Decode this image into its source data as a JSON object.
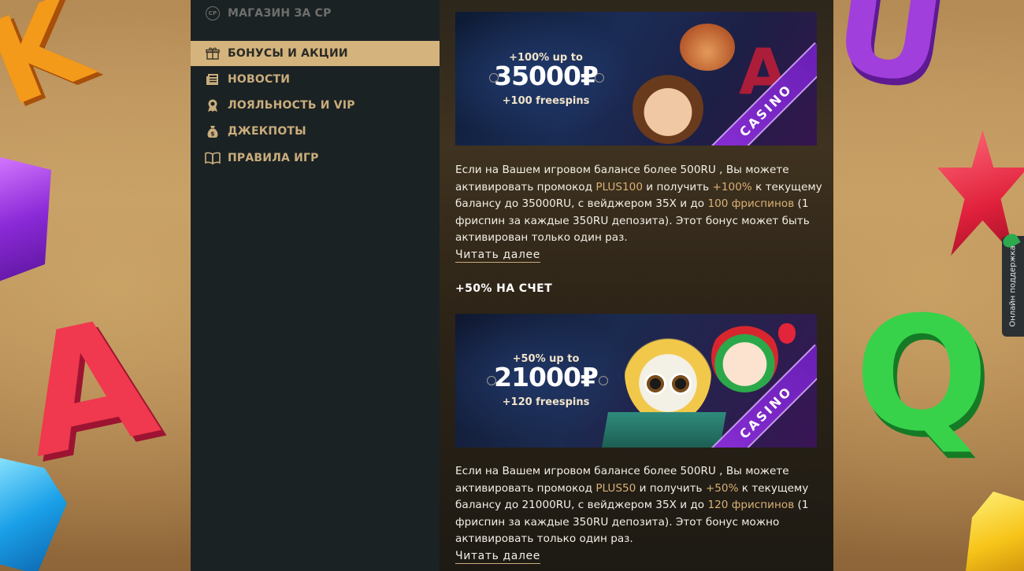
{
  "sidebar": {
    "items": [
      {
        "label": "МАГАЗИН ЗА СР",
        "icon": "cp-coin-icon",
        "state": "muted"
      },
      {
        "label": "БОНУСЫ И АКЦИИ",
        "icon": "gift-icon",
        "state": "active"
      },
      {
        "label": "НОВОСТИ",
        "icon": "newspaper-icon",
        "state": "normal"
      },
      {
        "label": "ЛОЯЛЬНОСТЬ И VIP",
        "icon": "medal-icon",
        "state": "normal"
      },
      {
        "label": "ДЖЕКПОТЫ",
        "icon": "money-bag-icon",
        "state": "normal"
      },
      {
        "label": "ПРАВИЛА ИГР",
        "icon": "book-icon",
        "state": "normal"
      }
    ],
    "cp_badge": "CP"
  },
  "promos": [
    {
      "banner": {
        "up_to": "+100% up to",
        "amount": "35000₽",
        "freespins": "+100 freespins",
        "ribbon": "CASINO"
      },
      "description": {
        "t1": "Если на Вашем игровом балансе более 500RU , Вы можете активировать промокод ",
        "code": "PLUS100",
        "t2": " и получить ",
        "percent": "+100%",
        "t3": " к текущему балансу до 35000RU, с вейджером 35X и до ",
        "spins": "100 фриспинов",
        "t4": " (1 фриспин за каждые 350RU депозита). Этот бонус может быть активирован только один раз."
      },
      "read_more": "Читать далее"
    },
    {
      "title": "+50% НА СЧЕТ",
      "banner": {
        "up_to": "+50% up to",
        "amount": "21000₽",
        "freespins": "+120 freespins",
        "ribbon": "CASINO"
      },
      "description": {
        "t1": "Если на Вашем игровом балансе более 500RU , Вы можете активировать промокод ",
        "code": "PLUS50",
        "t2": " и получить ",
        "percent": "+50%",
        "t3": " к текущему балансу до 21000RU, с вейджером 35X и до ",
        "spins": "120 фриспинов",
        "t4": " (1 фриспин за каждые 350RU депозита). Этот бонус можно активировать только один раз."
      },
      "read_more": "Читать далее"
    }
  ],
  "support": {
    "label": "Онлайн поддержка"
  },
  "colors": {
    "accent": "#d4b47c",
    "highlight": "#d9b074",
    "sidebar_bg": "#1b2224",
    "ribbon": "#8a2fd6"
  }
}
